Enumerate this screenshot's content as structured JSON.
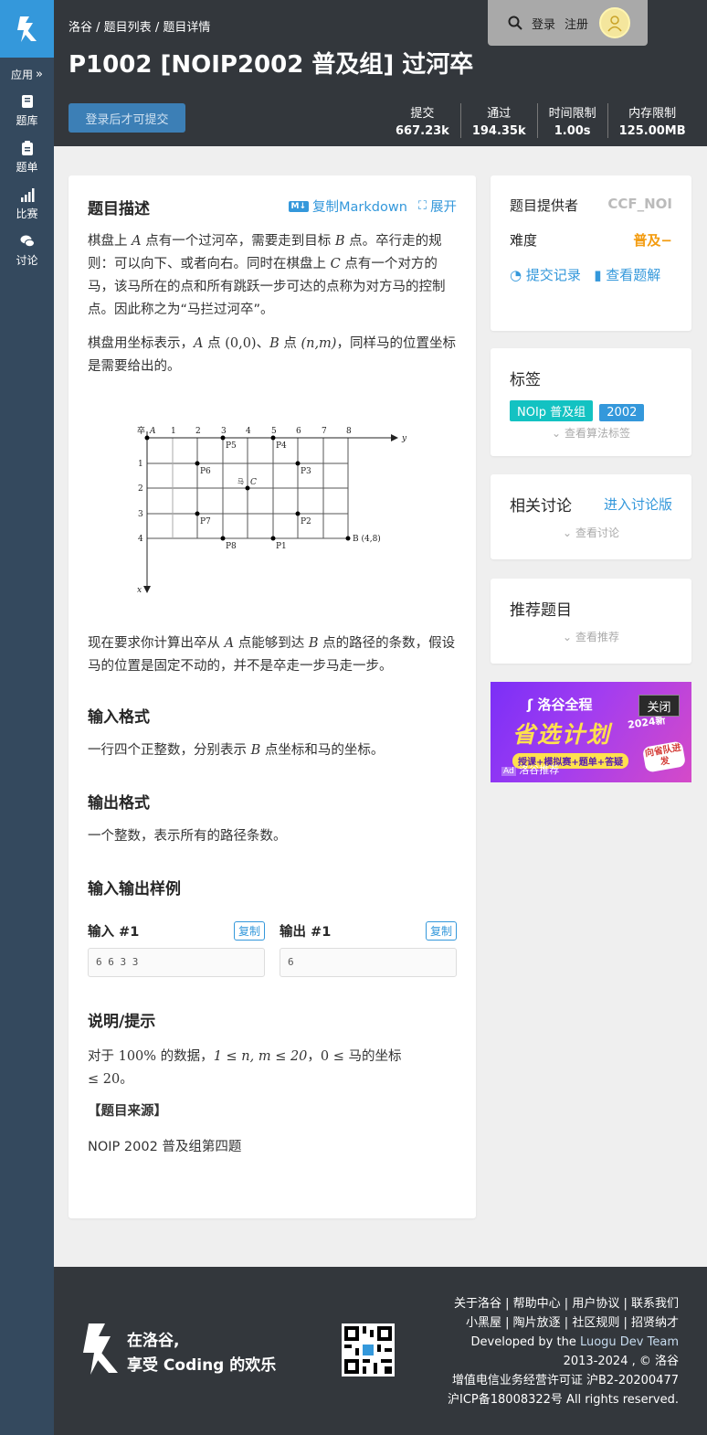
{
  "sidebar": {
    "apps_label": "应用",
    "items": [
      {
        "label": "题库",
        "icon": "book-icon"
      },
      {
        "label": "题单",
        "icon": "clipboard-icon"
      },
      {
        "label": "比赛",
        "icon": "bar-chart-icon"
      },
      {
        "label": "讨论",
        "icon": "comments-icon"
      }
    ]
  },
  "header": {
    "breadcrumb": [
      "洛谷",
      "题目列表",
      "题目详情"
    ],
    "title": "P1002 [NOIP2002 普及组] 过河卒",
    "login": "登录",
    "register": "注册",
    "submit_label": "登录后才可提交",
    "stats": [
      {
        "label": "提交",
        "value": "667.23k"
      },
      {
        "label": "通过",
        "value": "194.35k"
      },
      {
        "label": "时间限制",
        "value": "1.00s"
      },
      {
        "label": "内存限制",
        "value": "125.00MB"
      }
    ]
  },
  "problem": {
    "desc_heading": "题目描述",
    "copy_markdown": "复制Markdown",
    "expand": "展开",
    "desc_p1_a": "棋盘上 ",
    "desc_p1_b": " 点有一个过河卒，需要走到目标 ",
    "desc_p1_c": " 点。卒行走的规则：可以向下、或者向右。同时在棋盘上 ",
    "desc_p1_d": " 点有一个对方的马，该马所在的点和所有跳跃一步可达的点称为对方马的控制点。因此称之为“马拦过河卒”。",
    "desc_p2_a": "棋盘用坐标表示，",
    "desc_p2_b": " 点 ",
    "desc_p2_c": "、",
    "desc_p2_d": " 点 ",
    "desc_p2_e": "，同样马的位置坐标是需要给出的。",
    "desc_p3_a": "现在要求你计算出卒从 ",
    "desc_p3_b": " 点能够到达 ",
    "desc_p3_c": " 点的路径的条数，假设马的位置是固定不动的，并不是卒走一步马走一步。",
    "var_A": "A",
    "var_B": "B",
    "var_C": "C",
    "coord_A": "(0,0)",
    "coord_B": "(n,m)",
    "input_heading": "输入格式",
    "input_text_a": "一行四个正整数，分别表示 ",
    "input_text_b": " 点坐标和马的坐标。",
    "output_heading": "输出格式",
    "output_text": "一个整数，表示所有的路径条数。",
    "samples_heading": "输入输出样例",
    "input_label": "输入 #1",
    "output_label": "输出 #1",
    "copy": "复制",
    "sample_input": "6 6 3 3",
    "sample_output": "6",
    "hint_heading": "说明/提示",
    "hint_a": "对于 ",
    "hint_pct": "100%",
    "hint_b": " 的数据，",
    "hint_c": "1 ≤ n, m ≤ 20",
    "hint_d": "，",
    "hint_e": "0 ≤ ",
    "hint_f": "马的坐标",
    "hint_g": "≤ 20",
    "hint_h": "。",
    "source_heading": "【题目来源】",
    "source_text": "NOIP 2002 普及组第四题"
  },
  "figure": {
    "col_labels": [
      "1",
      "2",
      "3",
      "4",
      "5",
      "6",
      "7",
      "8"
    ],
    "row_labels": [
      "1",
      "2",
      "3",
      "4"
    ],
    "origin": "卒",
    "A": "A",
    "y_axis": "y",
    "x_axis": "x",
    "horse": "马",
    "C": "C",
    "B": "B (4,8)",
    "points": [
      "P1",
      "P2",
      "P3",
      "P4",
      "P5",
      "P6",
      "P7",
      "P8"
    ]
  },
  "info": {
    "provider_label": "题目提供者",
    "provider": "CCF_NOI",
    "difficulty_label": "难度",
    "difficulty": "普及−",
    "records": "提交记录",
    "solutions": "查看题解"
  },
  "tags": {
    "heading": "标签",
    "items": [
      "NOIp 普及组",
      "2002"
    ],
    "more": "查看算法标签"
  },
  "discuss": {
    "heading": "相关讨论",
    "enter": "进入讨论版",
    "more": "查看讨论"
  },
  "recommend": {
    "heading": "推荐题目",
    "more": "查看推荐"
  },
  "ad": {
    "brand": "洛谷全程",
    "headline": "省选计划",
    "year": "2024新",
    "close": "关闭",
    "subtitle": "授课+模拟赛+题单+答疑",
    "badge": "向省队进发",
    "tag": "Ad",
    "label": "洛谷推荐"
  },
  "footer": {
    "slogan1": "在洛谷,",
    "slogan2": "享受 Coding 的欢乐",
    "links1": [
      "关于洛谷",
      "帮助中心",
      "用户协议",
      "联系我们"
    ],
    "links2": [
      "小黑屋",
      "陶片放逐",
      "社区规则",
      "招贤纳才"
    ],
    "dev_prefix": "Developed by the ",
    "dev_team": "Luogu Dev Team",
    "copyright": "2013-2024 , © 洛谷",
    "license": "增值电信业务经营许可证 沪B2-20200477",
    "icp": "沪ICP备18008322号 All rights reserved."
  },
  "colors": {
    "sidebar": "#34495e",
    "accent": "#3498db",
    "header": "#33373c",
    "difficulty": "#f39c11",
    "tag_teal": "#13c2c2",
    "tag_blue": "#3498db"
  }
}
